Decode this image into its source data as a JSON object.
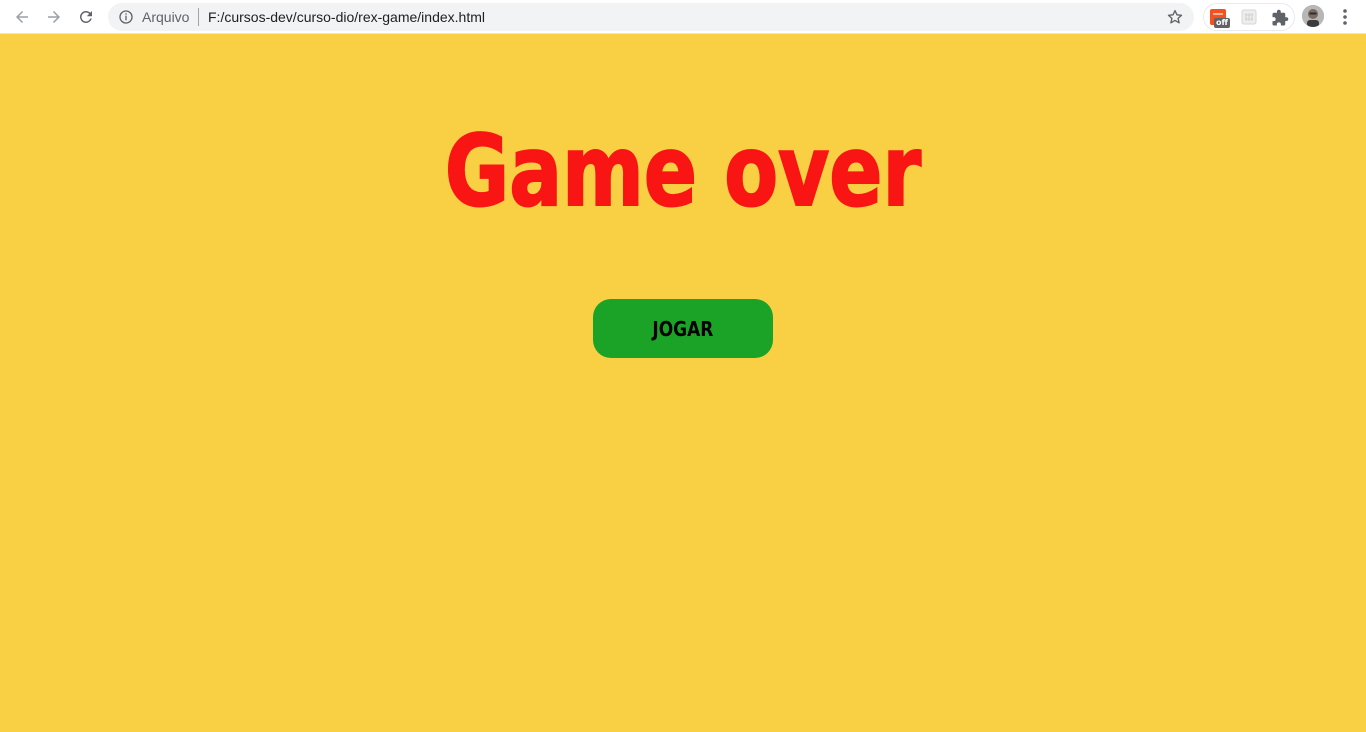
{
  "browser": {
    "scheme_label": "Arquivo",
    "url": "F:/cursos-dev/curso-dio/rex-game/index.html",
    "extension_badge": "off",
    "icons": {
      "back": "arrow-left-icon",
      "forward": "arrow-right-icon",
      "reload": "reload-icon",
      "info": "info-icon",
      "bookmark": "star-icon",
      "extensions": "puzzle-icon",
      "menu": "kebab-menu-icon"
    }
  },
  "game": {
    "title": "Game over",
    "play_button": "JOGAR",
    "colors": {
      "background": "#f9cf44",
      "title": "#f91514",
      "button": "#1ba328"
    }
  }
}
